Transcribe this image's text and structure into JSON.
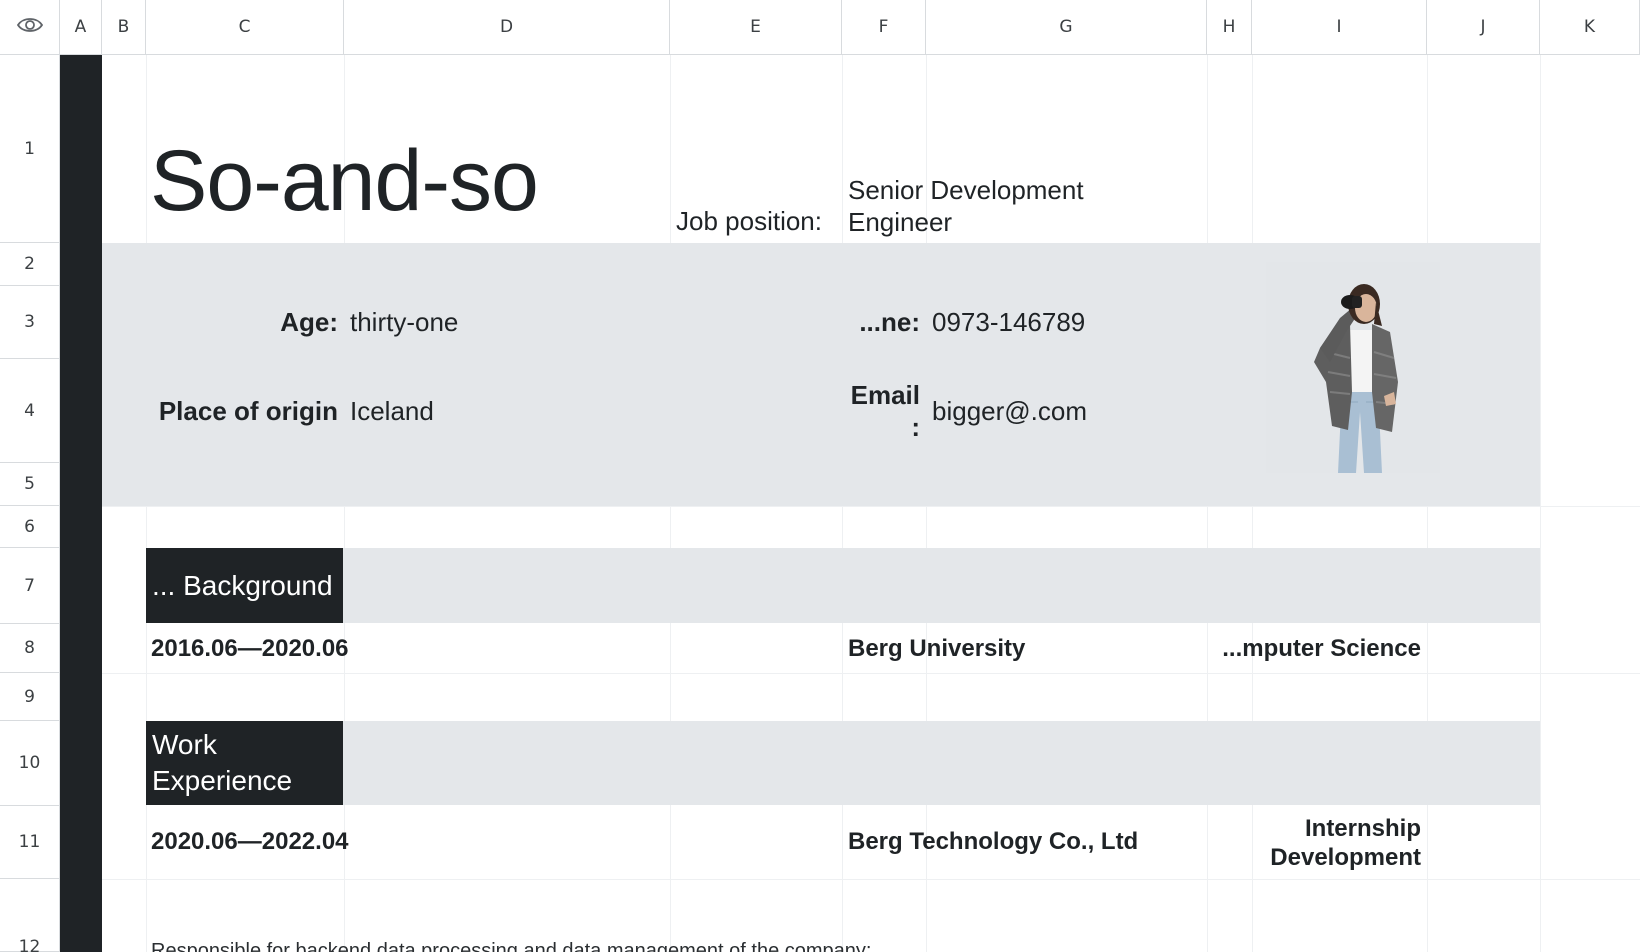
{
  "columns": [
    "A",
    "B",
    "C",
    "D",
    "E",
    "F",
    "G",
    "H",
    "I",
    "J",
    "K"
  ],
  "rows": [
    "1",
    "2",
    "3",
    "4",
    "5",
    "6",
    "7",
    "8",
    "9",
    "10",
    "11",
    "12"
  ],
  "resume": {
    "name": "So-and-so",
    "job_position_label": "Job position:",
    "job_position_value": "Senior Development Engineer",
    "age_label": "Age:",
    "age_value": "thirty-one",
    "origin_label": "Place of origin",
    "origin_value": "Iceland",
    "phone_label": "...ne:",
    "phone_value": "0973-146789",
    "email_label": "Email",
    "email_colon": ":",
    "email_value": "bigger@.com",
    "education_header": "... Background",
    "edu_dates": "2016.06—2020.06",
    "edu_school": "Berg University",
    "edu_major": "...mputer Science",
    "work_header_line1": "Work",
    "work_header_line2": "Experience",
    "work_dates": "2020.06—2022.04",
    "work_company": "Berg Technology Co., Ltd",
    "work_role_line1": "Internship",
    "work_role_line2": "Development",
    "work_desc": "Responsible for backend data processing and data management of the company;"
  },
  "icons": {
    "corner": "eye-icon"
  },
  "colors": {
    "dark": "#1f2326",
    "band": "#e4e7ea",
    "grid": "#d8dbde"
  }
}
